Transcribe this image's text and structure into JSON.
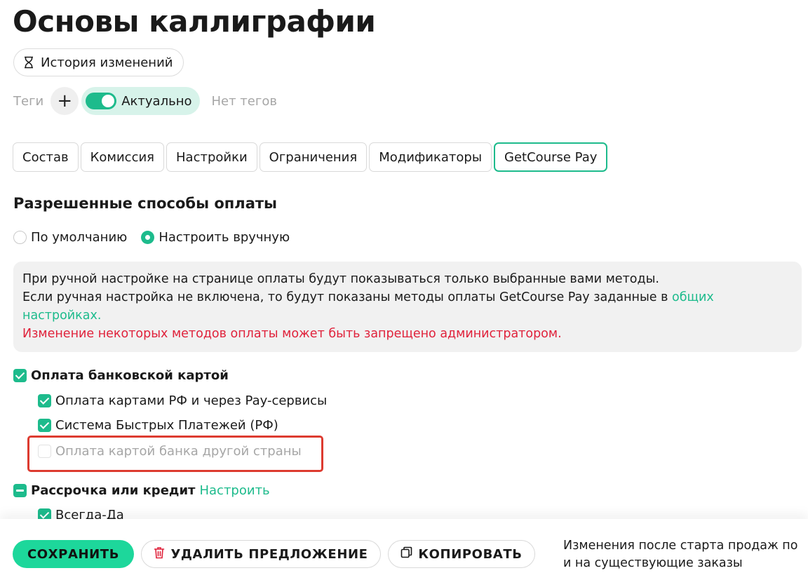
{
  "title": "Основы каллиграфии",
  "history": {
    "label": "История изменений"
  },
  "tags": {
    "label": "Теги",
    "add": "+",
    "toggle_label": "Актуально",
    "empty": "Нет тегов"
  },
  "tabs": [
    {
      "label": "Состав"
    },
    {
      "label": "Комиссия"
    },
    {
      "label": "Настройки"
    },
    {
      "label": "Ограничения"
    },
    {
      "label": "Модификаторы"
    },
    {
      "label": "GetCourse Pay",
      "active": true
    }
  ],
  "payment_methods": {
    "title": "Разрешенные способы оплаты",
    "mode_options": [
      {
        "label": "По умолчанию",
        "selected": false
      },
      {
        "label": "Настроить вручную",
        "selected": true
      }
    ],
    "info": {
      "line1": "При ручной настройке на странице оплаты будут показываться только выбранные вами методы.",
      "line2_text": "Если ручная настройка не включена, то будут показаны методы оплаты GetCourse Pay заданные в ",
      "line2_link": "общих настройках.",
      "warning": "Изменение некоторых методов оплаты может быть запрещено администратором."
    },
    "bank_card": {
      "label": "Оплата банковской картой",
      "items": [
        {
          "label": "Оплата картами РФ и через Pay-сервисы",
          "checked": true
        },
        {
          "label": "Система Быстрых Платежей (РФ)",
          "checked": true
        },
        {
          "label": "Оплата картой банка другой страны",
          "checked": false,
          "disabled": true
        }
      ]
    },
    "installment": {
      "label": "Рассрочка или кредит",
      "configure_link": "Настроить",
      "items": [
        {
          "label": "Всегда-Да",
          "checked": true
        }
      ]
    }
  },
  "footer": {
    "save": "СОХРАНИТЬ",
    "delete": "УДАЛИТЬ ПРЕДЛОЖЕНИЕ",
    "copy": "КОПИРОВАТЬ",
    "note_line1": "Изменения после старта продаж по",
    "note_line2": "и на существующие заказы"
  },
  "colors": {
    "accent": "#1dbb8c",
    "save_button": "#1dd79b",
    "warning_text": "#e0223b",
    "highlight": "#dd3b30",
    "muted_text": "#a6a6a6"
  },
  "icons": {
    "history": "hourglass-icon",
    "delete": "trash-icon",
    "copy": "copy-icon"
  }
}
